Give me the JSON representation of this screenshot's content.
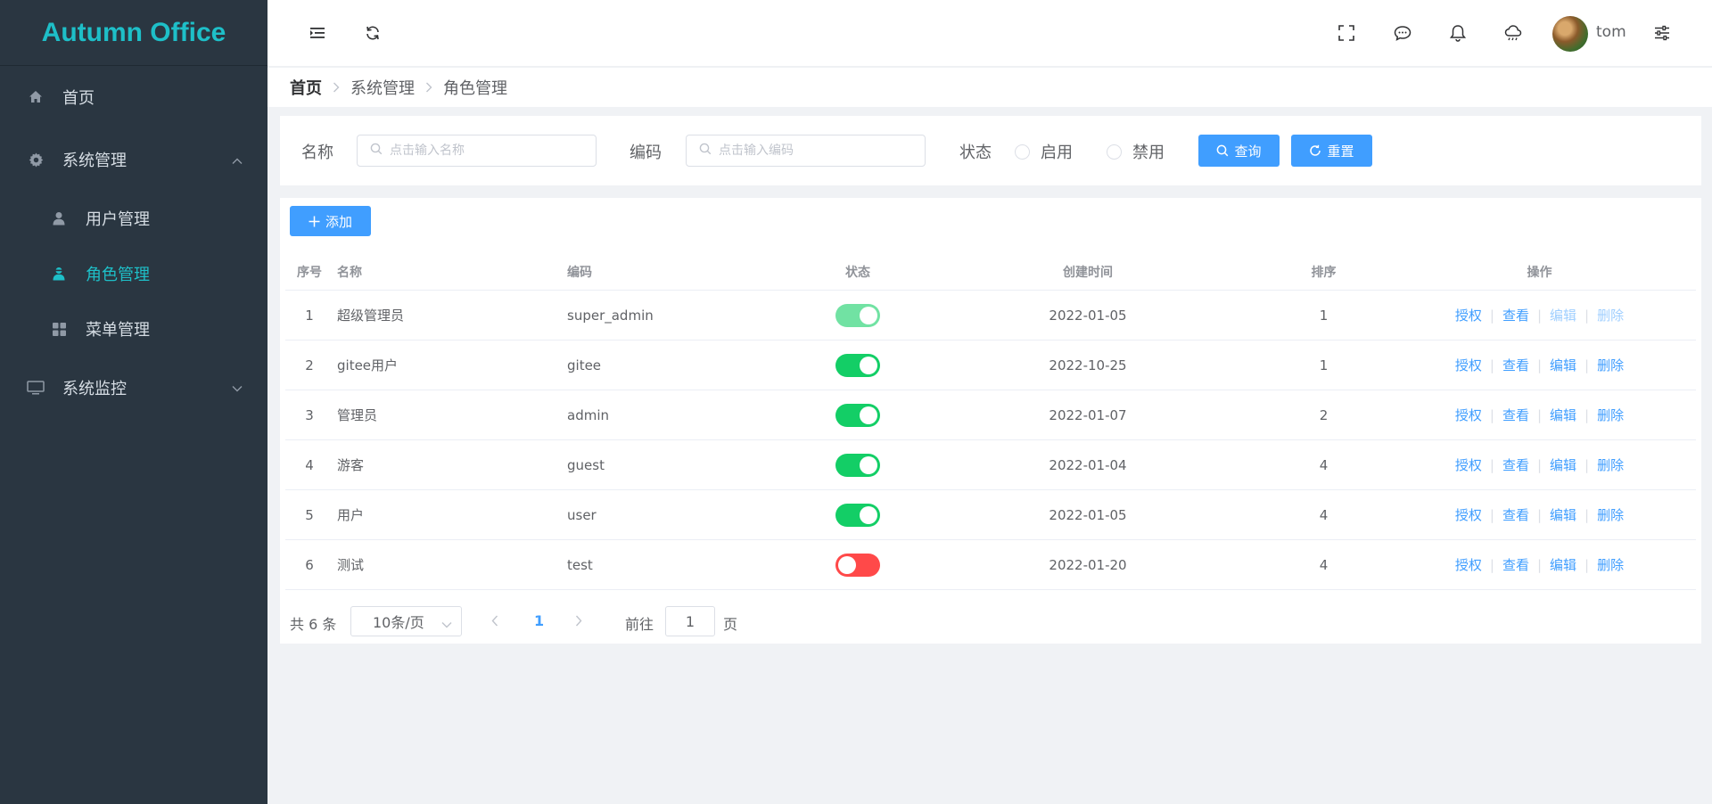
{
  "app": {
    "title": "Autumn Office",
    "brand_color": "#1ebfc8"
  },
  "sidebar": {
    "items": [
      {
        "label": "首页",
        "icon": "home-icon"
      },
      {
        "label": "系统管理",
        "icon": "gear-icon",
        "expanded": true
      },
      {
        "label": "系统监控",
        "icon": "monitor-icon",
        "expanded": false
      }
    ],
    "submenu": [
      {
        "label": "用户管理",
        "icon": "user-icon",
        "active": false
      },
      {
        "label": "角色管理",
        "icon": "role-icon",
        "active": true
      },
      {
        "label": "菜单管理",
        "icon": "grid-icon",
        "active": false
      }
    ]
  },
  "header": {
    "username": "tom"
  },
  "breadcrumb": {
    "home": "首页",
    "level1": "系统管理",
    "level2": "角色管理"
  },
  "search": {
    "name_label": "名称",
    "name_placeholder": "点击输入名称",
    "code_label": "编码",
    "code_placeholder": "点击输入编码",
    "status_label": "状态",
    "status_enabled": "启用",
    "status_disabled": "禁用",
    "query_button": "查询",
    "reset_button": "重置"
  },
  "toolbar": {
    "add_button": "添加"
  },
  "table": {
    "columns": [
      "序号",
      "名称",
      "编码",
      "状态",
      "创建时间",
      "排序",
      "操作"
    ],
    "rows": [
      {
        "index": "1",
        "name": "超级管理员",
        "code": "super_admin",
        "status": "on",
        "status_disabled_look": true,
        "created": "2022-01-05",
        "sort": "1",
        "edit_disabled": true
      },
      {
        "index": "2",
        "name": "gitee用户",
        "code": "gitee",
        "status": "on",
        "status_disabled_look": false,
        "created": "2022-10-25",
        "sort": "1",
        "edit_disabled": false
      },
      {
        "index": "3",
        "name": "管理员",
        "code": "admin",
        "status": "on",
        "status_disabled_look": false,
        "created": "2022-01-07",
        "sort": "2",
        "edit_disabled": false
      },
      {
        "index": "4",
        "name": "游客",
        "code": "guest",
        "status": "on",
        "status_disabled_look": false,
        "created": "2022-01-04",
        "sort": "4",
        "edit_disabled": false
      },
      {
        "index": "5",
        "name": "用户",
        "code": "user",
        "status": "on",
        "status_disabled_look": false,
        "created": "2022-01-05",
        "sort": "4",
        "edit_disabled": false
      },
      {
        "index": "6",
        "name": "测试",
        "code": "test",
        "status": "off",
        "status_disabled_look": false,
        "created": "2022-01-20",
        "sort": "4",
        "edit_disabled": false
      }
    ],
    "actions": {
      "authorize": "授权",
      "view": "查看",
      "edit": "编辑",
      "delete": "删除"
    },
    "colors": {
      "switch_on": "#13ce66",
      "switch_off": "#ff4949",
      "switch_on_disabled": "#71e2a3"
    }
  },
  "pagination": {
    "total_text": "共 6 条",
    "page_size": "10条/页",
    "current_page": "1",
    "goto_label": "前往",
    "goto_value": "1",
    "page_suffix": "页"
  }
}
